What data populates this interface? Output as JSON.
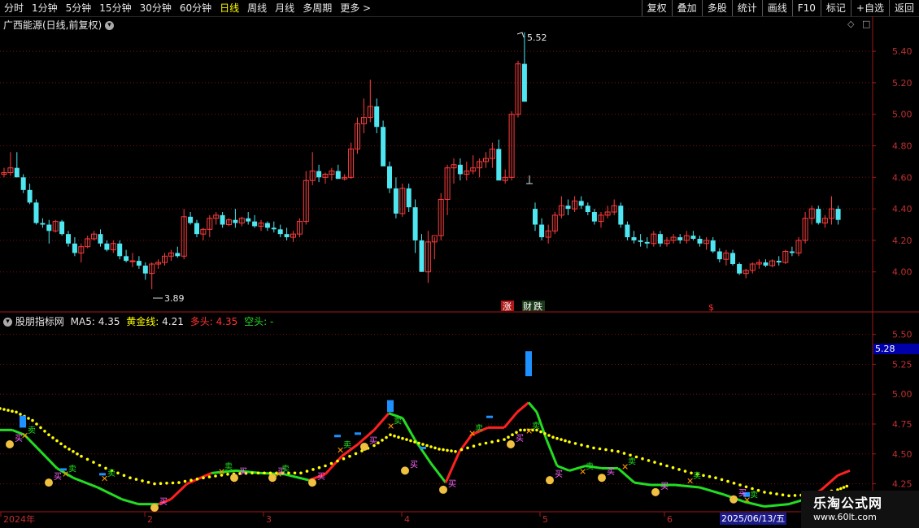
{
  "toolbar": {
    "periods": [
      "分时",
      "1分钟",
      "5分钟",
      "15分钟",
      "30分钟",
      "60分钟",
      "日线",
      "周线",
      "月线",
      "多周期",
      "更多 >"
    ],
    "active_period": "日线",
    "actions": [
      "复权",
      "叠加",
      "多股",
      "统计",
      "画线",
      "F10",
      "标记",
      "+自选",
      "返回"
    ]
  },
  "main_panel": {
    "title": "广西能源(日线,前复权)",
    "y_ticks": [
      "5.40",
      "5.20",
      "5.00",
      "4.80",
      "4.60",
      "4.40",
      "4.20",
      "4.00"
    ],
    "high_label": "5.52",
    "low_label": "3.89",
    "event_labels": [
      "涨",
      "财",
      "跌",
      "$"
    ]
  },
  "indicator_panel": {
    "name": "股朋指标网",
    "ma5_label": "MA5:",
    "ma5_value": "4.35",
    "gold_label": "黄金线:",
    "gold_value": "4.21",
    "long_label": "多头:",
    "long_value": "4.35",
    "short_label": "空头:",
    "short_value": "-",
    "y_ticks": [
      "5.50",
      "5.25",
      "5.00",
      "4.75",
      "4.50",
      "4.25"
    ],
    "current_value": "5.28",
    "buy_label": "买",
    "sell_label": "卖"
  },
  "x_axis": {
    "labels": [
      "2024年",
      "2",
      "3",
      "4",
      "5",
      "6"
    ],
    "date_badge": "2025/06/13/五"
  },
  "watermark": {
    "title": "乐淘公式网",
    "url": "www.60lt.com"
  },
  "colors": {
    "up": "#ff3c3c",
    "down": "#4ee6f0",
    "grid": "#7a1010",
    "ma_green": "#22dd22",
    "ma_red": "#ff2020",
    "gold_line": "#ffff00",
    "bar_blue": "#1e90ff"
  },
  "chart_data": {
    "type": "candlestick",
    "y_range": [
      3.88,
      5.55
    ],
    "candles": [
      [
        4.62,
        4.66,
        4.6,
        4.63
      ],
      [
        4.63,
        4.76,
        4.61,
        4.66
      ],
      [
        4.66,
        4.76,
        4.62,
        4.6
      ],
      [
        4.6,
        4.62,
        4.5,
        4.52
      ],
      [
        4.52,
        4.56,
        4.43,
        4.44
      ],
      [
        4.44,
        4.46,
        4.3,
        4.31
      ],
      [
        4.31,
        4.34,
        4.28,
        4.3
      ],
      [
        4.3,
        4.33,
        4.18,
        4.26
      ],
      [
        4.26,
        4.33,
        4.25,
        4.32
      ],
      [
        4.32,
        4.33,
        4.23,
        4.24
      ],
      [
        4.24,
        4.26,
        4.16,
        4.18
      ],
      [
        4.18,
        4.22,
        4.1,
        4.12
      ],
      [
        4.12,
        4.18,
        4.06,
        4.16
      ],
      [
        4.16,
        4.23,
        4.15,
        4.21
      ],
      [
        4.21,
        4.26,
        4.2,
        4.24
      ],
      [
        4.24,
        4.27,
        4.16,
        4.18
      ],
      [
        4.18,
        4.2,
        4.13,
        4.14
      ],
      [
        4.14,
        4.2,
        4.12,
        4.18
      ],
      [
        4.18,
        4.2,
        4.08,
        4.1
      ],
      [
        4.1,
        4.14,
        4.06,
        4.07
      ],
      [
        4.07,
        4.12,
        4.03,
        4.07
      ],
      [
        4.07,
        4.1,
        4.02,
        4.04
      ],
      [
        4.04,
        4.06,
        3.95,
        3.99
      ],
      [
        3.99,
        4.06,
        3.89,
        4.05
      ],
      [
        4.05,
        4.08,
        4.02,
        4.06
      ],
      [
        4.06,
        4.12,
        4.04,
        4.1
      ],
      [
        4.1,
        4.14,
        4.07,
        4.12
      ],
      [
        4.12,
        4.16,
        4.09,
        4.1
      ],
      [
        4.1,
        4.4,
        4.08,
        4.35
      ],
      [
        4.35,
        4.38,
        4.3,
        4.31
      ],
      [
        4.31,
        4.33,
        4.22,
        4.24
      ],
      [
        4.24,
        4.28,
        4.2,
        4.27
      ],
      [
        4.27,
        4.36,
        4.22,
        4.34
      ],
      [
        4.34,
        4.38,
        4.3,
        4.36
      ],
      [
        4.36,
        4.38,
        4.28,
        4.3
      ],
      [
        4.3,
        4.34,
        4.29,
        4.33
      ],
      [
        4.33,
        4.4,
        4.28,
        4.31
      ],
      [
        4.31,
        4.35,
        4.29,
        4.34
      ],
      [
        4.34,
        4.38,
        4.3,
        4.32
      ],
      [
        4.32,
        4.36,
        4.28,
        4.29
      ],
      [
        4.29,
        4.33,
        4.26,
        4.31
      ],
      [
        4.31,
        4.32,
        4.26,
        4.28
      ],
      [
        4.28,
        4.32,
        4.25,
        4.27
      ],
      [
        4.27,
        4.3,
        4.22,
        4.24
      ],
      [
        4.24,
        4.28,
        4.2,
        4.22
      ],
      [
        4.22,
        4.26,
        4.19,
        4.24
      ],
      [
        4.24,
        4.34,
        4.22,
        4.32
      ],
      [
        4.32,
        4.64,
        4.3,
        4.58
      ],
      [
        4.58,
        4.76,
        4.55,
        4.64
      ],
      [
        4.64,
        4.68,
        4.57,
        4.6
      ],
      [
        4.6,
        4.63,
        4.56,
        4.62
      ],
      [
        4.62,
        4.66,
        4.58,
        4.64
      ],
      [
        4.64,
        4.68,
        4.6,
        4.59
      ],
      [
        4.59,
        4.62,
        4.58,
        4.6
      ],
      [
        4.6,
        4.82,
        4.59,
        4.78
      ],
      [
        4.78,
        4.98,
        4.75,
        4.94
      ],
      [
        4.94,
        5.1,
        4.88,
        4.98
      ],
      [
        4.98,
        5.22,
        4.95,
        5.05
      ],
      [
        5.05,
        5.1,
        4.88,
        4.92
      ],
      [
        4.92,
        4.96,
        4.76,
        4.67
      ],
      [
        4.67,
        4.7,
        4.5,
        4.53
      ],
      [
        4.53,
        4.6,
        4.34,
        4.37
      ],
      [
        4.37,
        4.56,
        4.35,
        4.53
      ],
      [
        4.53,
        4.56,
        4.38,
        4.41
      ],
      [
        4.41,
        4.46,
        4.12,
        4.2
      ],
      [
        4.2,
        4.24,
        4.0,
        4.0
      ],
      [
        4.0,
        4.26,
        3.93,
        4.19
      ],
      [
        4.19,
        4.22,
        4.08,
        4.23
      ],
      [
        4.23,
        4.5,
        4.2,
        4.46
      ],
      [
        4.46,
        4.68,
        4.36,
        4.66
      ],
      [
        4.66,
        4.72,
        4.56,
        4.68
      ],
      [
        4.68,
        4.72,
        4.58,
        4.62
      ],
      [
        4.62,
        4.7,
        4.58,
        4.64
      ],
      [
        4.64,
        4.74,
        4.62,
        4.66
      ],
      [
        4.66,
        4.72,
        4.6,
        4.7
      ],
      [
        4.7,
        4.76,
        4.66,
        4.72
      ],
      [
        4.72,
        4.82,
        4.66,
        4.78
      ],
      [
        4.78,
        4.84,
        4.7,
        4.58
      ],
      [
        4.58,
        4.65,
        4.56,
        4.6
      ],
      [
        4.6,
        5.02,
        4.58,
        5.0
      ],
      [
        5.0,
        5.34,
        4.98,
        5.32
      ],
      [
        5.32,
        5.52,
        5.1,
        5.08
      ]
    ]
  }
}
